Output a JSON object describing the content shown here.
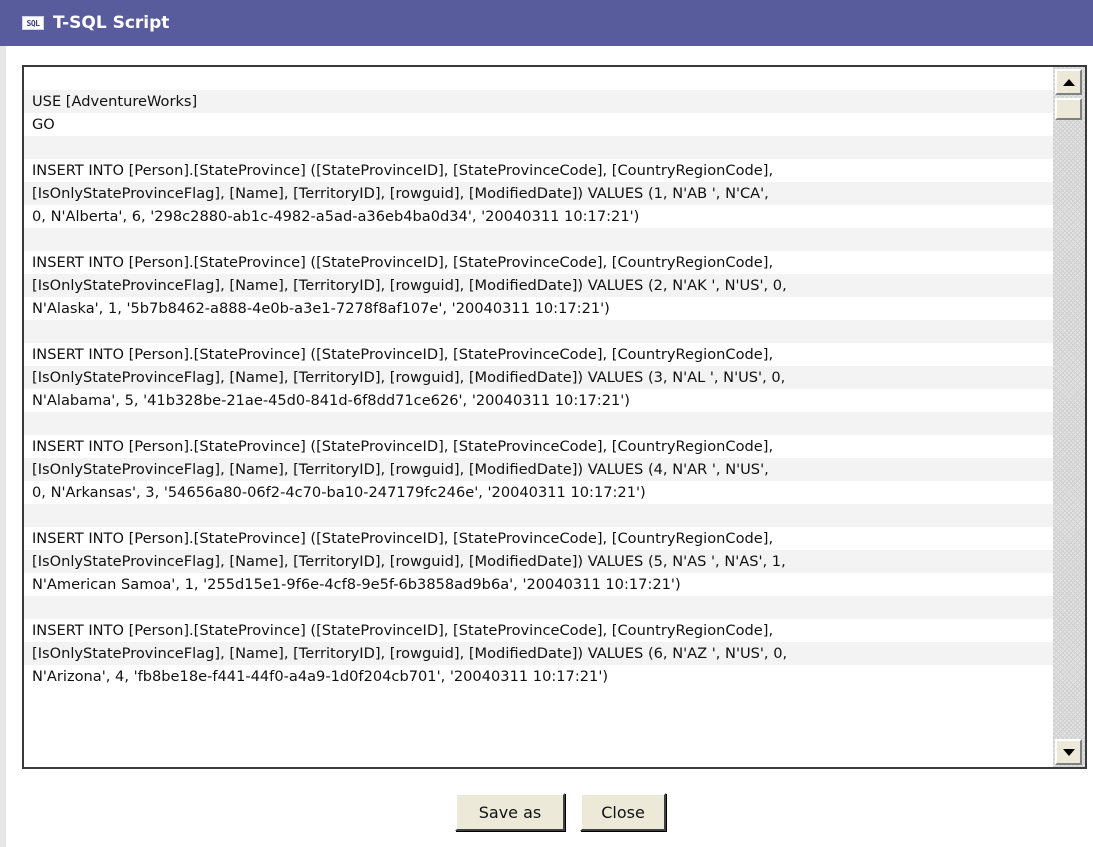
{
  "window": {
    "icon_text": "SQL",
    "title": "T-SQL Script"
  },
  "script": {
    "lines": [
      "",
      "USE [AdventureWorks]",
      "GO",
      "",
      "INSERT INTO [Person].[StateProvince] ([StateProvinceID], [StateProvinceCode], [CountryRegionCode],",
      "[IsOnlyStateProvinceFlag], [Name], [TerritoryID], [rowguid], [ModifiedDate]) VALUES (1, N'AB ', N'CA',",
      "0, N'Alberta', 6, '298c2880-ab1c-4982-a5ad-a36eb4ba0d34', '20040311 10:17:21')",
      "",
      "INSERT INTO [Person].[StateProvince] ([StateProvinceID], [StateProvinceCode], [CountryRegionCode],",
      "[IsOnlyStateProvinceFlag], [Name], [TerritoryID], [rowguid], [ModifiedDate]) VALUES (2, N'AK ', N'US', 0,",
      "N'Alaska', 1, '5b7b8462-a888-4e0b-a3e1-7278f8af107e', '20040311 10:17:21')",
      "",
      "INSERT INTO [Person].[StateProvince] ([StateProvinceID], [StateProvinceCode], [CountryRegionCode],",
      "[IsOnlyStateProvinceFlag], [Name], [TerritoryID], [rowguid], [ModifiedDate]) VALUES (3, N'AL ', N'US', 0,",
      "N'Alabama', 5, '41b328be-21ae-45d0-841d-6f8dd71ce626', '20040311 10:17:21')",
      "",
      "INSERT INTO [Person].[StateProvince] ([StateProvinceID], [StateProvinceCode], [CountryRegionCode],",
      "[IsOnlyStateProvinceFlag], [Name], [TerritoryID], [rowguid], [ModifiedDate]) VALUES (4, N'AR ', N'US',",
      "0, N'Arkansas', 3, '54656a80-06f2-4c70-ba10-247179fc246e', '20040311 10:17:21')",
      "",
      "INSERT INTO [Person].[StateProvince] ([StateProvinceID], [StateProvinceCode], [CountryRegionCode],",
      "[IsOnlyStateProvinceFlag], [Name], [TerritoryID], [rowguid], [ModifiedDate]) VALUES (5, N'AS ', N'AS', 1,",
      "N'American Samoa', 1, '255d15e1-9f6e-4cf8-9e5f-6b3858ad9b6a', '20040311 10:17:21')",
      "",
      "INSERT INTO [Person].[StateProvince] ([StateProvinceID], [StateProvinceCode], [CountryRegionCode],",
      "[IsOnlyStateProvinceFlag], [Name], [TerritoryID], [rowguid], [ModifiedDate]) VALUES (6, N'AZ ', N'US', 0,",
      "N'Arizona', 4, 'fb8be18e-f441-44f0-a4a9-1d0f204cb701', '20040311 10:17:21')"
    ]
  },
  "buttons": {
    "save_as": "Save as",
    "close": "Close"
  },
  "colors": {
    "titlebar": "#585c9c",
    "title_text": "#ffffff",
    "button_face": "#ece9d8"
  },
  "icons": {
    "title_icon": "sql-script-icon",
    "scroll_up": "arrow-up-icon",
    "scroll_down": "arrow-down-icon"
  }
}
